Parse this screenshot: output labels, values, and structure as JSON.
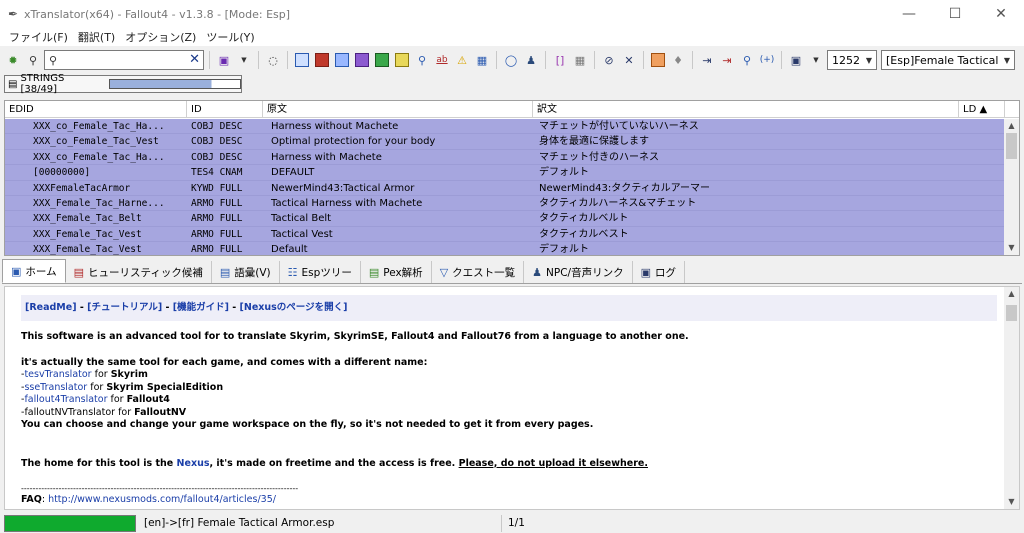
{
  "window": {
    "title": "xTranslator(x64) - Fallout4 - v1.3.8 - [Mode: Esp]",
    "minimize": "—",
    "maximize": "☐",
    "close": "✕"
  },
  "menu": [
    "ファイル(F)",
    "翻訳(T)",
    "オプション(Z)",
    "ツール(Y)"
  ],
  "toolbar": {
    "search_value": "",
    "codepage": "1252",
    "esp_file": "[Esp]Female Tactical Armo"
  },
  "strings_tab": {
    "label": "STRINGS [38/49]",
    "progress": 0.78
  },
  "grid": {
    "columns": [
      "EDID",
      "ID",
      "原文",
      "訳文",
      "LD ▲"
    ],
    "rows": [
      {
        "edid": "XXX_co_Female_Tac_Ha...",
        "id": "COBJ DESC",
        "source": "Harness without Machete",
        "dest": "マチェットが付いていないハーネス"
      },
      {
        "edid": "XXX_co_Female_Tac_Vest",
        "id": "COBJ DESC",
        "source": "Optimal protection for your body",
        "dest": "身体を最適に保護します"
      },
      {
        "edid": "XXX_co_Female_Tac_Ha...",
        "id": "COBJ DESC",
        "source": "Harness with Machete",
        "dest": "マチェット付きのハーネス"
      },
      {
        "edid": "[00000000]",
        "id": "TES4 CNAM",
        "source": "DEFAULT",
        "dest": "デフォルト"
      },
      {
        "edid": "XXXFemaleTacArmor",
        "id": "KYWD FULL",
        "source": "NewerMind43:Tactical Armor",
        "dest": "NewerMind43:タクティカルアーマー"
      },
      {
        "edid": "XXX_Female_Tac_Harne...",
        "id": "ARMO FULL",
        "source": "Tactical Harness with Machete",
        "dest": "タクティカルハーネス&マチェット"
      },
      {
        "edid": "XXX_Female_Tac_Belt",
        "id": "ARMO FULL",
        "source": "Tactical Belt",
        "dest": "タクティカルベルト"
      },
      {
        "edid": "XXX_Female_Tac_Vest",
        "id": "ARMO FULL",
        "source": "Tactical Vest",
        "dest": "タクティカルベスト"
      },
      {
        "edid": "XXX_Female_Tac_Vest",
        "id": "ARMO FULL",
        "source": "Default",
        "dest": "デフォルト"
      }
    ]
  },
  "tabs": [
    {
      "label": "ホーム",
      "icon": "home-icon"
    },
    {
      "label": "ヒューリスティック候補",
      "icon": "heuristic-icon"
    },
    {
      "label": "語彙(V)",
      "icon": "vocab-icon"
    },
    {
      "label": "Espツリー",
      "icon": "tree-icon"
    },
    {
      "label": "Pex解析",
      "icon": "pex-icon"
    },
    {
      "label": "クエスト一覧",
      "icon": "quest-icon"
    },
    {
      "label": "NPC/音声リンク",
      "icon": "npc-icon"
    },
    {
      "label": "ログ",
      "icon": "log-icon"
    }
  ],
  "home": {
    "links": {
      "readme": "[ReadMe]",
      "sep1": " - ",
      "tutorial": "[チュートリアル]",
      "sep2": " - ",
      "guide": "[機能ガイド]",
      "sep3": " - ",
      "nexus": "[Nexusのページを開く]"
    },
    "intro": "This software is an advanced tool for to translate Skyrim, SkyrimSE, Fallout4 and Fallout76 from a language to another one.",
    "same_tool": "it's actually the same tool for each game, and comes with a different name:",
    "tools": [
      {
        "prefix": "-",
        "link": "tesvTranslator",
        "mid": " for ",
        "game": "Skyrim"
      },
      {
        "prefix": "-",
        "link": "sseTranslator",
        "mid": " for ",
        "game": "Skyrim SpecialEdition"
      },
      {
        "prefix": "-",
        "link": "fallout4Translator",
        "mid": " for ",
        "game": "Fallout4"
      },
      {
        "prefix": "-",
        "link": "falloutNVTranslator",
        "mid": " for ",
        "game": "FalloutNV"
      }
    ],
    "workspace": "You can choose and change your game workspace on the fly, so it's not needed to get it from every pages.",
    "home_a": "The home for this tool is the ",
    "home_link": "Nexus",
    "home_b": ", it's made on freetime and the access is free. ",
    "home_upload": "Please, do not upload it elsewhere.",
    "dash": "------------------------------------------------------------------------------------------------",
    "faq_label": "FAQ",
    "faq_colon": ": ",
    "faq_url": "http://www.nexusmods.com/fallout4/articles/35/"
  },
  "status": {
    "progress": 1.0,
    "text": "[en]->[fr] Female Tactical Armor.esp",
    "count": "1/1"
  },
  "colors": {
    "row_bg": "#a6a6df",
    "link": "#1a3ea8",
    "status_green": "#0faa2e"
  }
}
